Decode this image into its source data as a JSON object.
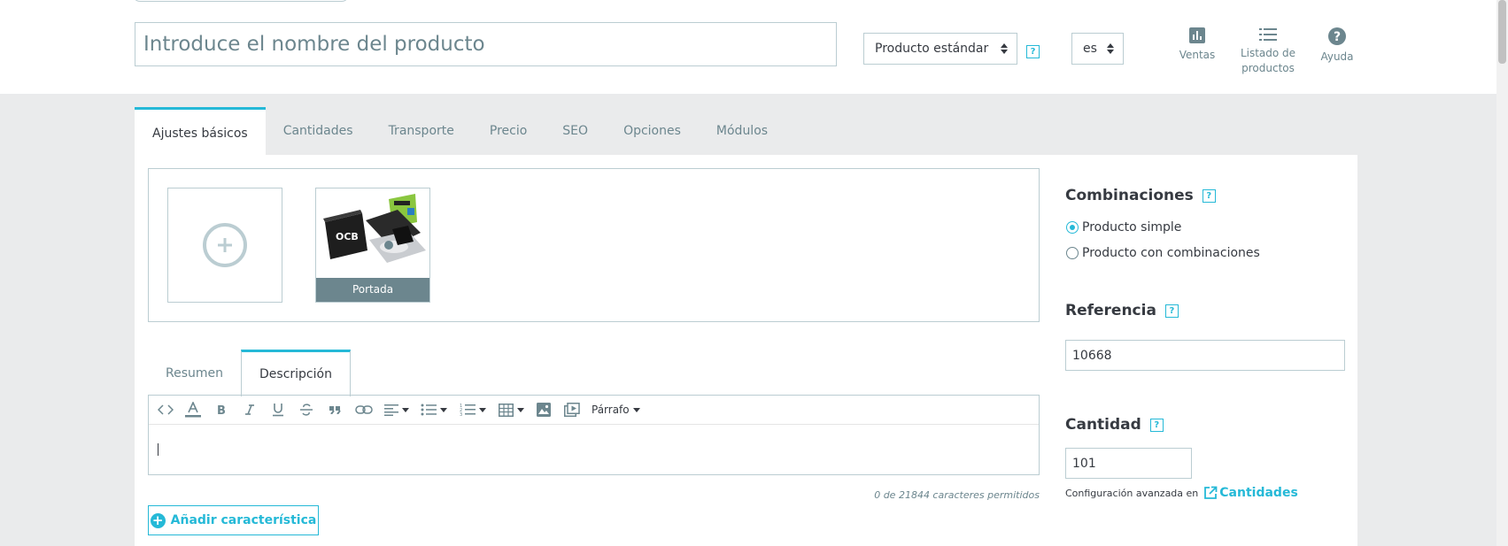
{
  "header": {
    "name_placeholder": "Introduce el nombre del producto",
    "product_type": "Producto estándar",
    "language": "es",
    "actions": {
      "sales": "Ventas",
      "product_list": [
        "Listado de",
        "productos"
      ],
      "help": "Ayuda"
    },
    "help_mark": "?"
  },
  "tabs": [
    {
      "label": "Ajustes básicos",
      "active": true
    },
    {
      "label": "Cantidades"
    },
    {
      "label": "Transporte"
    },
    {
      "label": "Precio"
    },
    {
      "label": "SEO"
    },
    {
      "label": "Opciones"
    },
    {
      "label": "Módulos"
    }
  ],
  "images": {
    "cover_caption": "Portada"
  },
  "description": {
    "tabs": [
      {
        "label": "Resumen"
      },
      {
        "label": "Descripción",
        "active": true
      }
    ],
    "toolbar": {
      "format_label": "Párrafo"
    },
    "char_count": "0 de 21844 caracteres permitidos"
  },
  "add_feature_label": "Añadir característica",
  "sidebar": {
    "combinations": {
      "title": "Combinaciones",
      "options": [
        "Producto simple",
        "Producto con combinaciones"
      ],
      "selected": "Producto simple"
    },
    "reference": {
      "title": "Referencia",
      "value": "10668"
    },
    "quantity": {
      "title": "Cantidad",
      "value": "101",
      "advanced_text": "Configuración avanzada en",
      "advanced_link": "Cantidades"
    }
  },
  "colors": {
    "accent": "#25b9d7",
    "text": "#363a41",
    "muted": "#6c868e",
    "border": "#bbcdd2",
    "background": "#eaebec"
  }
}
